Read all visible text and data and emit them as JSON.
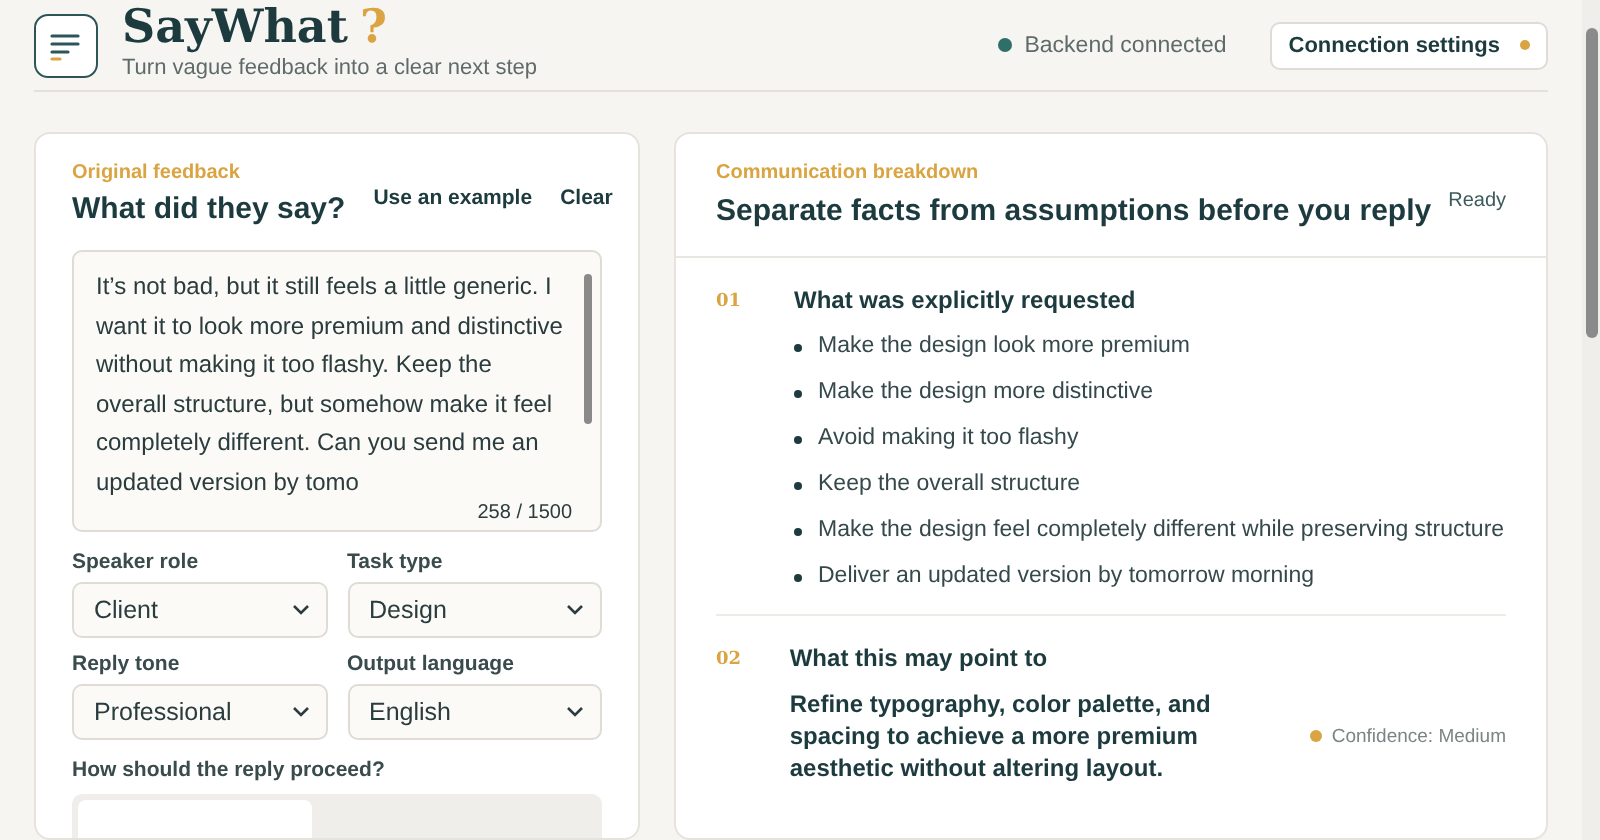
{
  "header": {
    "title": "SayWhat",
    "title_mark": "?",
    "subtitle": "Turn vague feedback into a clear next step",
    "backend_status": {
      "label": "Backend connected",
      "connected": true
    },
    "settings_button": {
      "label": "Connection settings",
      "attention": true
    }
  },
  "input_panel": {
    "eyebrow": "Original feedback",
    "title": "What did they say?",
    "actions": [
      "Use an example",
      "Clear"
    ],
    "feedback": {
      "value": "It’s not bad, but it still feels a little generic. I want it to look more premium and distinctive without making it too flashy. Keep the overall structure, but somehow make it feel completely different. Can you send me an updated version by tomo",
      "count": "258 / 1500"
    },
    "fields": [
      {
        "label": "Speaker role",
        "value": "Client"
      },
      {
        "label": "Task type",
        "value": "Design"
      },
      {
        "label": "Reply tone",
        "value": "Professional"
      },
      {
        "label": "Output language",
        "value": "English"
      }
    ],
    "proceed_label": "How should the reply proceed?"
  },
  "breakdown": {
    "eyebrow": "Communication breakdown",
    "title": "Separate facts from assumptions before you reply",
    "status": "Ready",
    "sections": [
      {
        "kind": "list",
        "number": "01",
        "title": "What was explicitly requested",
        "items": [
          "Make the design look more premium",
          "Make the design more distinctive",
          "Avoid making it too flashy",
          "Keep the overall structure",
          "Make the design feel completely different while preserving structure",
          "Deliver an updated version by tomorrow morning"
        ]
      },
      {
        "kind": "interpretation",
        "number": "02",
        "title": "What this may point to",
        "statement": "Refine typography, color palette, and spacing to achieve a more premium aesthetic without altering layout.",
        "confidence": {
          "label": "Confidence: Medium",
          "color": "#d9a441"
        }
      }
    ]
  }
}
